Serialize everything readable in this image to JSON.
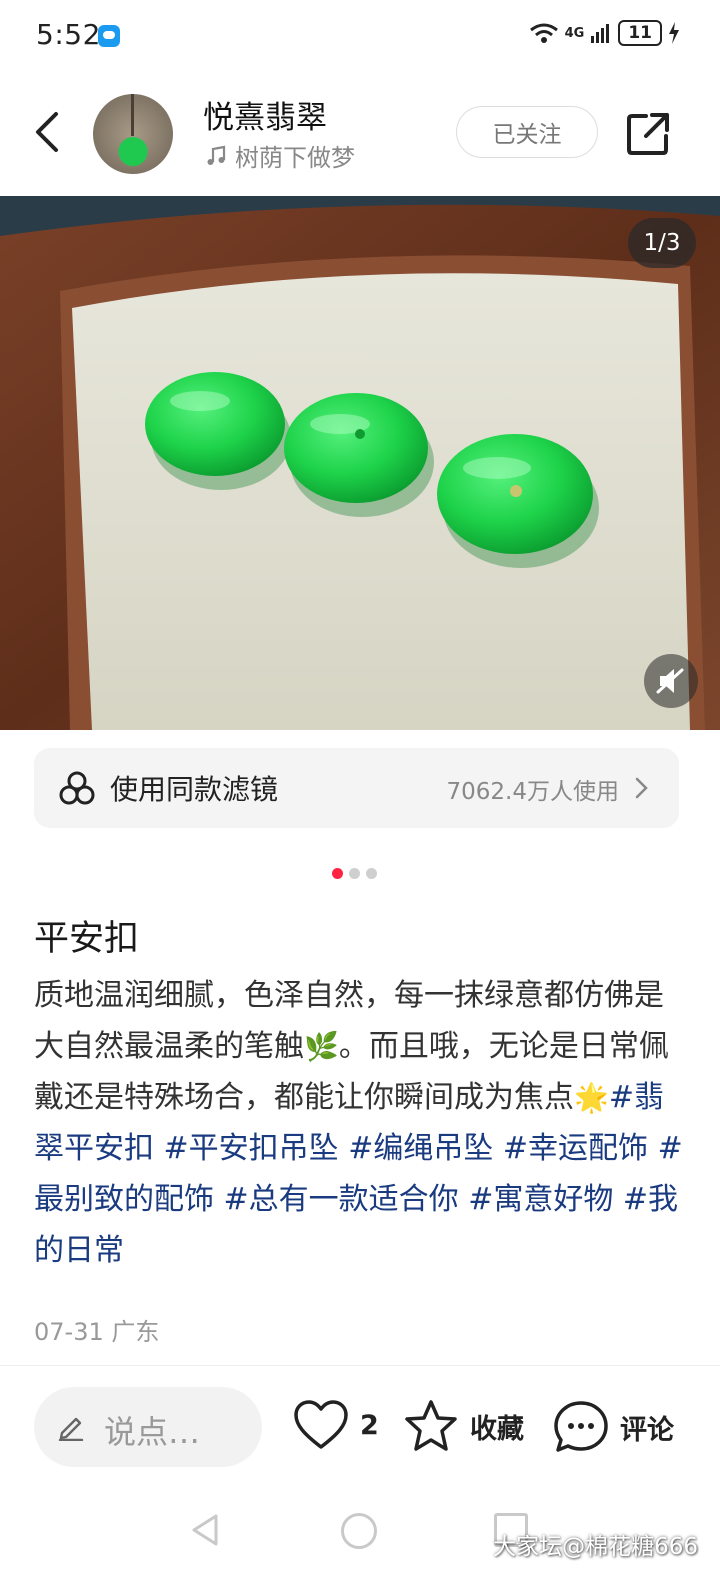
{
  "status_bar": {
    "time": "5:52",
    "network": "4G",
    "battery": "11"
  },
  "header": {
    "author_name": "悦熹翡翠",
    "music_title": "树荫下做梦",
    "follow_label": "已关注"
  },
  "photo": {
    "page_indicator": "1/3",
    "subject": "three green jade pingan buckle discs on a beige pad in a wooden tray"
  },
  "filter": {
    "label": "使用同款滤镜",
    "usage": "7062.4万人使用"
  },
  "carousel": {
    "current": 1,
    "total": 3
  },
  "post": {
    "title": "平安扣",
    "body_1": "质地温润细腻，色泽自然，每一抹绿意都仿佛是大自然最温柔的笔触",
    "body_2": "。而且哦，无论是日常佩戴还是特殊场合，都能让你瞬间成为焦点",
    "tags": [
      "#翡翠平安扣",
      "#平安扣吊坠",
      "#编绳吊坠",
      "#幸运配饰",
      "#最别致的配饰",
      "#总有一款适合你",
      "#寓意好物",
      "#我的日常"
    ],
    "meta": "07-31 广东"
  },
  "actions": {
    "comment_placeholder": "说点…",
    "like_count": "2",
    "favorite_label": "收藏",
    "comment_label": "评论"
  },
  "watermark": "大家坛@棉花糖666",
  "colors": {
    "accent": "#ff2442",
    "tag": "#1a3b80",
    "jade": "#1ed34a"
  }
}
